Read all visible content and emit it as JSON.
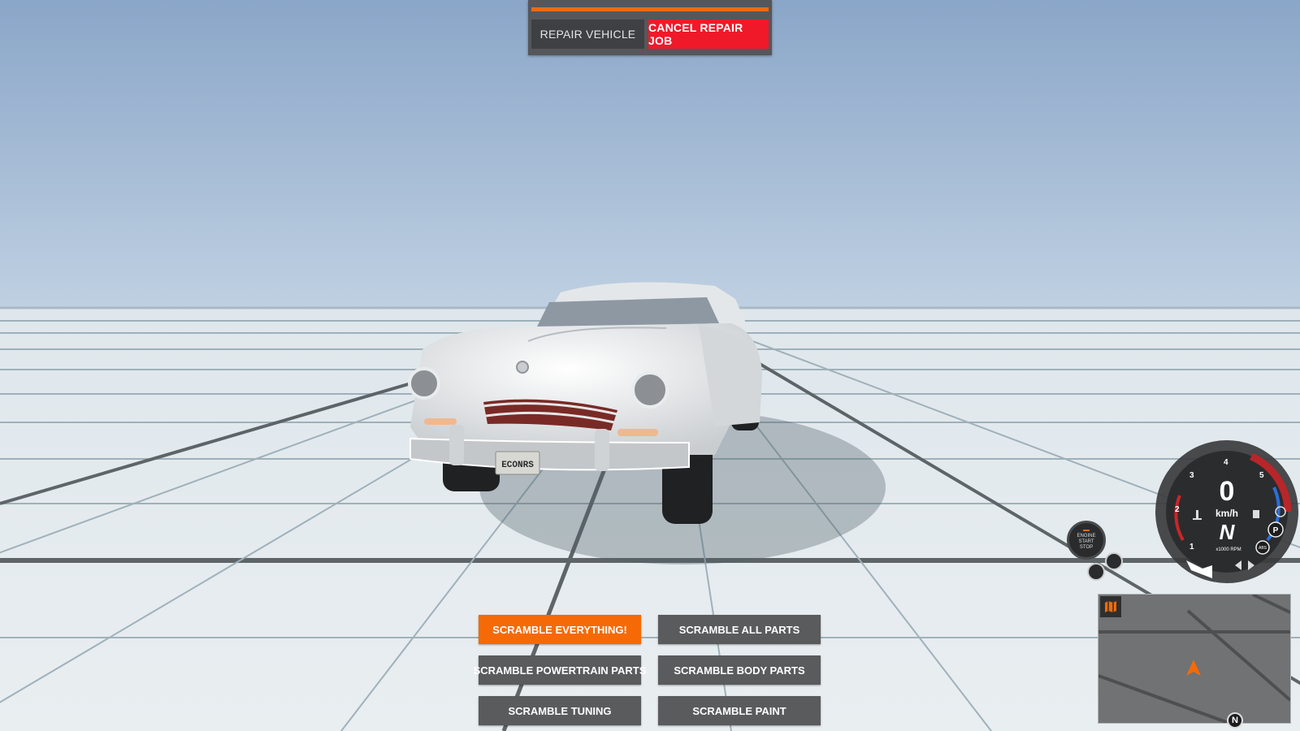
{
  "repair": {
    "progress_fraction": 1.0,
    "repair_label": "REPAIR VEHICLE",
    "cancel_label": "CANCEL REPAIR JOB"
  },
  "scramble": {
    "everything": "SCRAMBLE EVERYTHING!",
    "all_parts": "SCRAMBLE ALL PARTS",
    "powertrain": "SCRAMBLE POWERTRAIN PARTS",
    "body": "SCRAMBLE BODY PARTS",
    "tuning": "SCRAMBLE TUNING",
    "paint": "SCRAMBLE PAINT"
  },
  "vehicle": {
    "license_plate": "ECONRS"
  },
  "hud": {
    "speed": "0",
    "speed_unit": "km/h",
    "gear": "N",
    "rpm_unit": "x1000 RPM",
    "rpm_ticks": [
      "1",
      "2",
      "3",
      "4",
      "5"
    ],
    "engine_label_line1": "ENGINE",
    "engine_label_line2": "START",
    "engine_label_line3": "STOP",
    "parking_label": "P",
    "abs_label": "ABS",
    "compass_label": "N"
  },
  "colors": {
    "accent_orange": "#f56a06",
    "cancel_red": "#f0192a",
    "button_grey": "#5a5b5d"
  }
}
